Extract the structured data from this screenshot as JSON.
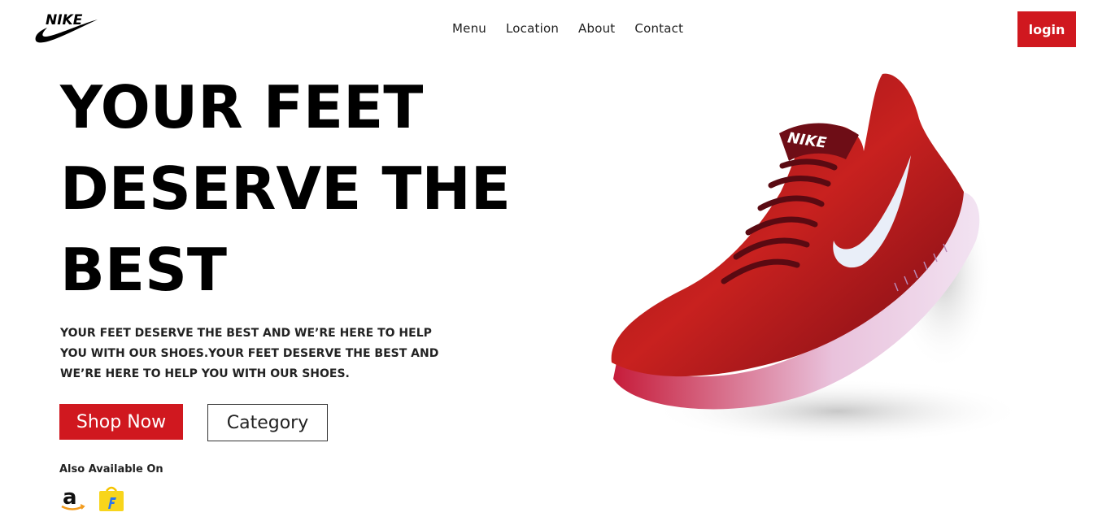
{
  "header": {
    "brand": "NIKE",
    "nav": [
      "Menu",
      "Location",
      "About",
      "Contact"
    ],
    "login_label": "login"
  },
  "hero": {
    "title_lines": [
      "YOUR FEET",
      "DESERVE THE",
      "BEST"
    ],
    "description": "YOUR FEET DESERVE THE BEST AND WE’RE HERE TO HELP YOU WITH OUR SHOES.YOUR FEET DESERVE THE BEST AND WE’RE HERE TO HELP YOU WITH OUR SHOES.",
    "shop_now_label": "Shop Now",
    "category_label": "Category",
    "available_label": "Also Available On",
    "stores": [
      "amazon-icon",
      "flipkart-icon"
    ]
  },
  "colors": {
    "accent": "#d0181f",
    "shoe_red": "#b3141c",
    "shoe_dark": "#6e0d16",
    "sole": "#e8d3e8"
  }
}
